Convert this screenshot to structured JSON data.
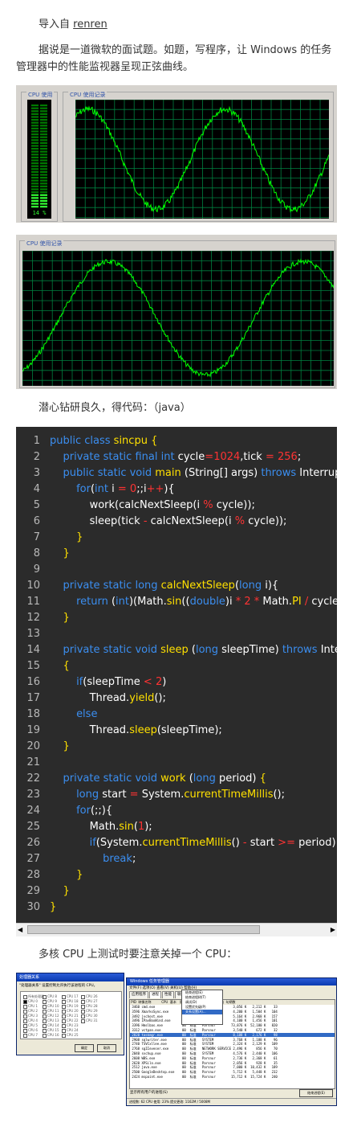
{
  "intro": {
    "prefix": "导入自 ",
    "source": "renren"
  },
  "para2": "据说是一道微软的面试题。如题，写程序，让 Windows 的任务管理器中的性能监视器呈现正弦曲线。",
  "monitor1": {
    "cpu_usage_label": "CPU 使用",
    "cpu_history_label": "CPU 使用记录",
    "cpu_percent": "14 %",
    "level_fraction": 0.14
  },
  "monitor2": {
    "cpu_history_label": "CPU 使用记录"
  },
  "para3": "潜心钻研良久，得代码：（java）",
  "code": {
    "line_numbers": [
      "1",
      "2",
      "3",
      "4",
      "5",
      "6",
      "7",
      "8",
      "9",
      "10",
      "11",
      "12",
      "13",
      "14",
      "15",
      "16",
      "17",
      "18",
      "19",
      "20",
      "21",
      "22",
      "23",
      "24",
      "25",
      "26",
      "27",
      "28",
      "29",
      "30"
    ]
  },
  "para4": "多核 CPU 上测试时要注意关掉一个 CPU：",
  "affinity_dialog": {
    "title": "处理器关系",
    "desc": "\"处理器关系\" 设置控制允许执行该进程的 CPU。",
    "cpus": [
      "所有处理器",
      "CPU 0",
      "CPU 1",
      "CPU 2",
      "CPU 3",
      "CPU 4",
      "CPU 5",
      "CPU 6",
      "CPU 7",
      "CPU 8",
      "CPU 9",
      "CPU 10",
      "CPU 11",
      "CPU 12",
      "CPU 13",
      "CPU 14",
      "CPU 15",
      "CPU 16",
      "CPU 17",
      "CPU 18",
      "CPU 19",
      "CPU 20",
      "CPU 21",
      "CPU 22",
      "CPU 23",
      "CPU 24",
      "CPU 25",
      "CPU 26",
      "CPU 27",
      "CPU 28",
      "CPU 29",
      "CPU 30",
      "CPU 31"
    ],
    "ok": "确定",
    "cancel": "取消"
  },
  "task_manager": {
    "title": "Windows 任务管理器",
    "menu": "文件(F)  选项(O)  查看(V)  关机(U)  帮助(H)",
    "tabs": [
      "应用程序",
      "进程",
      "性能",
      "联网",
      "用户"
    ],
    "header": " PID  映像名称          CPU  基本   用户名          内存使用  虚拟内  句柄数",
    "rows": [
      " 3460 cmd.exe              00  标准   Parsnur         3,056 K   2,212 K    33",
      " 3596 XmarksSync.exe       00  标准   SYSTEM          4,200 K   1,504 K   104",
      " 3492 jvchost.exe          00  标准   SYSTEM          5,164 K   2,968 K   157",
      " 3496 IPavBoxWind.exe      00  标准   SYSTEM          4,100 K   1,456 K   101",
      " 3396 Hmslbas.exe          00  标准   Parsnur        73,876 K  52,180 K   820",
      " 3312 vctpan.exe           00  标准   Parsnur         3,540 K     672 K    32",
      " 2820 taskmgr.exe          00  标准   Parsnur         8,188 K   2,176 K    98",
      " 2908 sqlwriter.exe        00  标准   SYSTEM          3,768 K   1,188 K    96",
      " 2740 TSVCxllee.exe        00  标准   SYSTEM          2,324 K   2,129 K   109",
      " 2768 sgIIeveser.exe       00  标准   NETWORK SERVICE 2,496 K     856 K    70",
      " 2040 svchup.exe           00  标准   SYSTEM          4,576 K   2,440 K   106",
      " 2608 WBS.exe              00  标准   Parsnur         2,736 K   2,368 K    61",
      " 2620 XPSilo.exe           00  标准   Parsnur         2,056 K     928 K    35",
      " 2512 java.exe             00  标准   Parsnur         7,000 K  10,432 K   189",
      " 2500 GoogleDesktop.exe    00  标准   Parsnur         5,712 K   5,448 K   232",
      " 2424 mspaint.exe          00  标准   Parsnur        15,712 K  15,724 K   240"
    ],
    "context_menu": [
      "结束进程(E)",
      "结束进程树(T)",
      "调试(D)",
      "设置优先级(P)",
      "关系设置(A)..."
    ],
    "show_all": "显示所有用户的进程(S)",
    "end_process": "结束进程(E)",
    "status": "进程数: 62     CPU 使用: 23%     提交更改: 1162M / 5008M"
  }
}
